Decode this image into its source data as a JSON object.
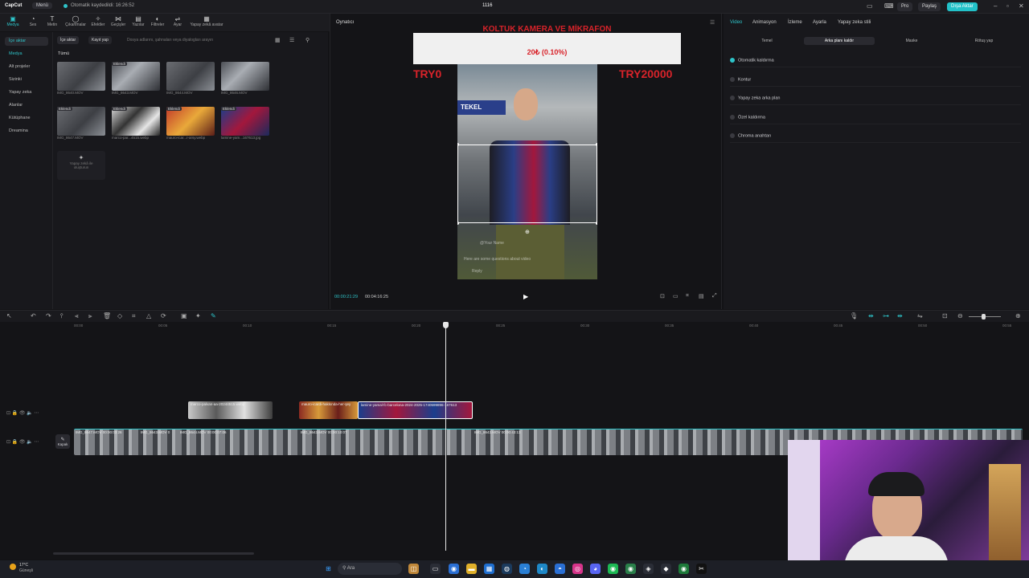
{
  "topbar": {
    "app": "CapCut",
    "menu": "Menü",
    "saved": "Otomatik kaydedildi: 16:26:52",
    "project": "1116",
    "pro": "Pro",
    "share": "Paylaş",
    "export": "Dışa Aktar"
  },
  "tools": [
    "Medya",
    "Ses",
    "Metin",
    "Çıkartmalar",
    "Efektler",
    "Geçişler",
    "Yazılar",
    "Filtreler",
    "Ayar",
    "Yapay zekâ avatar"
  ],
  "leftnav": [
    "İçe aktar",
    "Medya",
    "Alt projeler",
    "Sizinki",
    "Yapay zeka",
    "Alanlar",
    "Kütüphane",
    "Dreamina"
  ],
  "media": {
    "import_btn": "İçe aktar",
    "record_btn": "Kayıt yap",
    "search_placeholder": "Dosya adlarını, şahnaları veya diyalogları arayın",
    "all": "Tümü",
    "added_badge": "Eklendi",
    "items": [
      {
        "name": "IMG_8640.MOV"
      },
      {
        "name": "IMG_8643.MOV"
      },
      {
        "name": "IMG_8644.MOV"
      },
      {
        "name": "IMG_8646.MOV"
      },
      {
        "name": "IMG_8647.MOV"
      },
      {
        "name": "marco-par...4515.webp"
      },
      {
        "name": "mauro-icar...r-arsy.webp"
      },
      {
        "name": "lamine-yam...167613.jpg"
      }
    ],
    "ai_label": "Yapay zekâ ile oluşturun"
  },
  "player": {
    "label": "Oynatıcı",
    "headline": "KOLTUK KAMERA VE MİKRAFON",
    "price": "20₺ (0.10%)",
    "left_amount": "TRY0",
    "right_amount": "TRY20000",
    "shop_sign": "TEKEL",
    "overlay_name": "@Your Name",
    "overlay_text": "Here are some questions about video",
    "overlay_small": "Reply",
    "time_current": "00:00:21:29",
    "time_total": "00:04:16:25"
  },
  "props": {
    "tabs": [
      "Video",
      "Animasyon",
      "İzleme",
      "Ayarla",
      "Yapay zeka stili"
    ],
    "subtabs": [
      "Temel",
      "Arka planı kaldır",
      "Maske",
      "Rötuş yap"
    ],
    "rows": [
      "Otomatik kaldırma",
      "Kontur",
      "Yapay zeka arka plan",
      "Özel kaldırma",
      "Chroma anahtarı"
    ]
  },
  "timeline": {
    "ruler": [
      "00:00",
      "00:05",
      "00:10",
      "00:15",
      "00:20",
      "00:25",
      "00:30",
      "00:35",
      "00:40",
      "00:45",
      "00:50",
      "00:55"
    ],
    "clip1": "marco-palvan-aa-20244515.webp",
    "clip2": "mauro-icardi-hakkında-her-şey",
    "clip3": "lamine-yamal-fc-barcelona-2024-2025-1740599896-167613",
    "main_labels": [
      "IMG_8647.MOV  00:00:03:26",
      "IMG_8643.MOV  0",
      "IMG_8644.MOV  00:00:07:06",
      "IMG_8643.MOV  00:00:10:07",
      "IMG_8643.MOV  00:00:43:13"
    ],
    "cover": "Kapak"
  },
  "taskbar": {
    "weather_temp": "17°C",
    "weather_desc": "Güneşli",
    "search": "Ara"
  }
}
